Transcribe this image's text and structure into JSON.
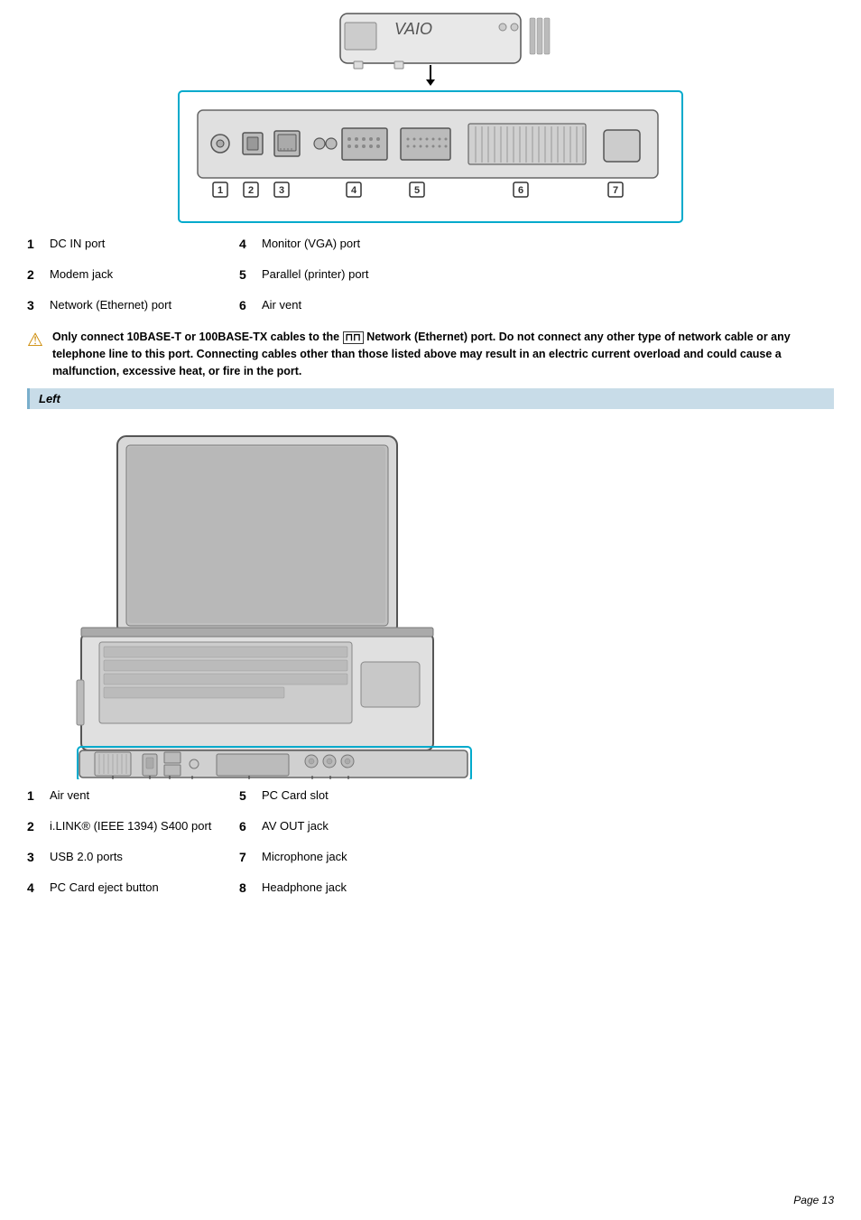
{
  "page": {
    "number": "Page 13"
  },
  "top_section": {
    "rear_ports": [
      {
        "number": "1",
        "name": "DC IN port",
        "col2_number": "4",
        "col2_name": "Monitor (VGA) port"
      },
      {
        "number": "2",
        "name": "Modem jack",
        "col2_number": "5",
        "col2_name": "Parallel (printer) port"
      },
      {
        "number": "3",
        "name": "Network (Ethernet) port",
        "col2_number": "6",
        "col2_name": "Air vent"
      }
    ],
    "warning": "Only connect 10BASE-T or 100BASE-TX cables to the  Network (Ethernet) port. Do not connect any other type of network cable or any telephone line to this port. Connecting cables other than those listed above may result in an electric current overload and could cause a malfunction, excessive heat, or fire in the port."
  },
  "left_section": {
    "header": "Left",
    "ports": [
      {
        "number": "1",
        "name": "Air vent",
        "col2_number": "5",
        "col2_name": "PC Card slot"
      },
      {
        "number": "2",
        "name": "i.LINK® (IEEE 1394) S400 port",
        "col2_number": "6",
        "col2_name": "AV OUT jack"
      },
      {
        "number": "3",
        "name": "USB 2.0 ports",
        "col2_number": "7",
        "col2_name": "Microphone jack"
      },
      {
        "number": "4",
        "name": "PC Card eject button",
        "col2_number": "8",
        "col2_name": "Headphone jack"
      }
    ]
  }
}
